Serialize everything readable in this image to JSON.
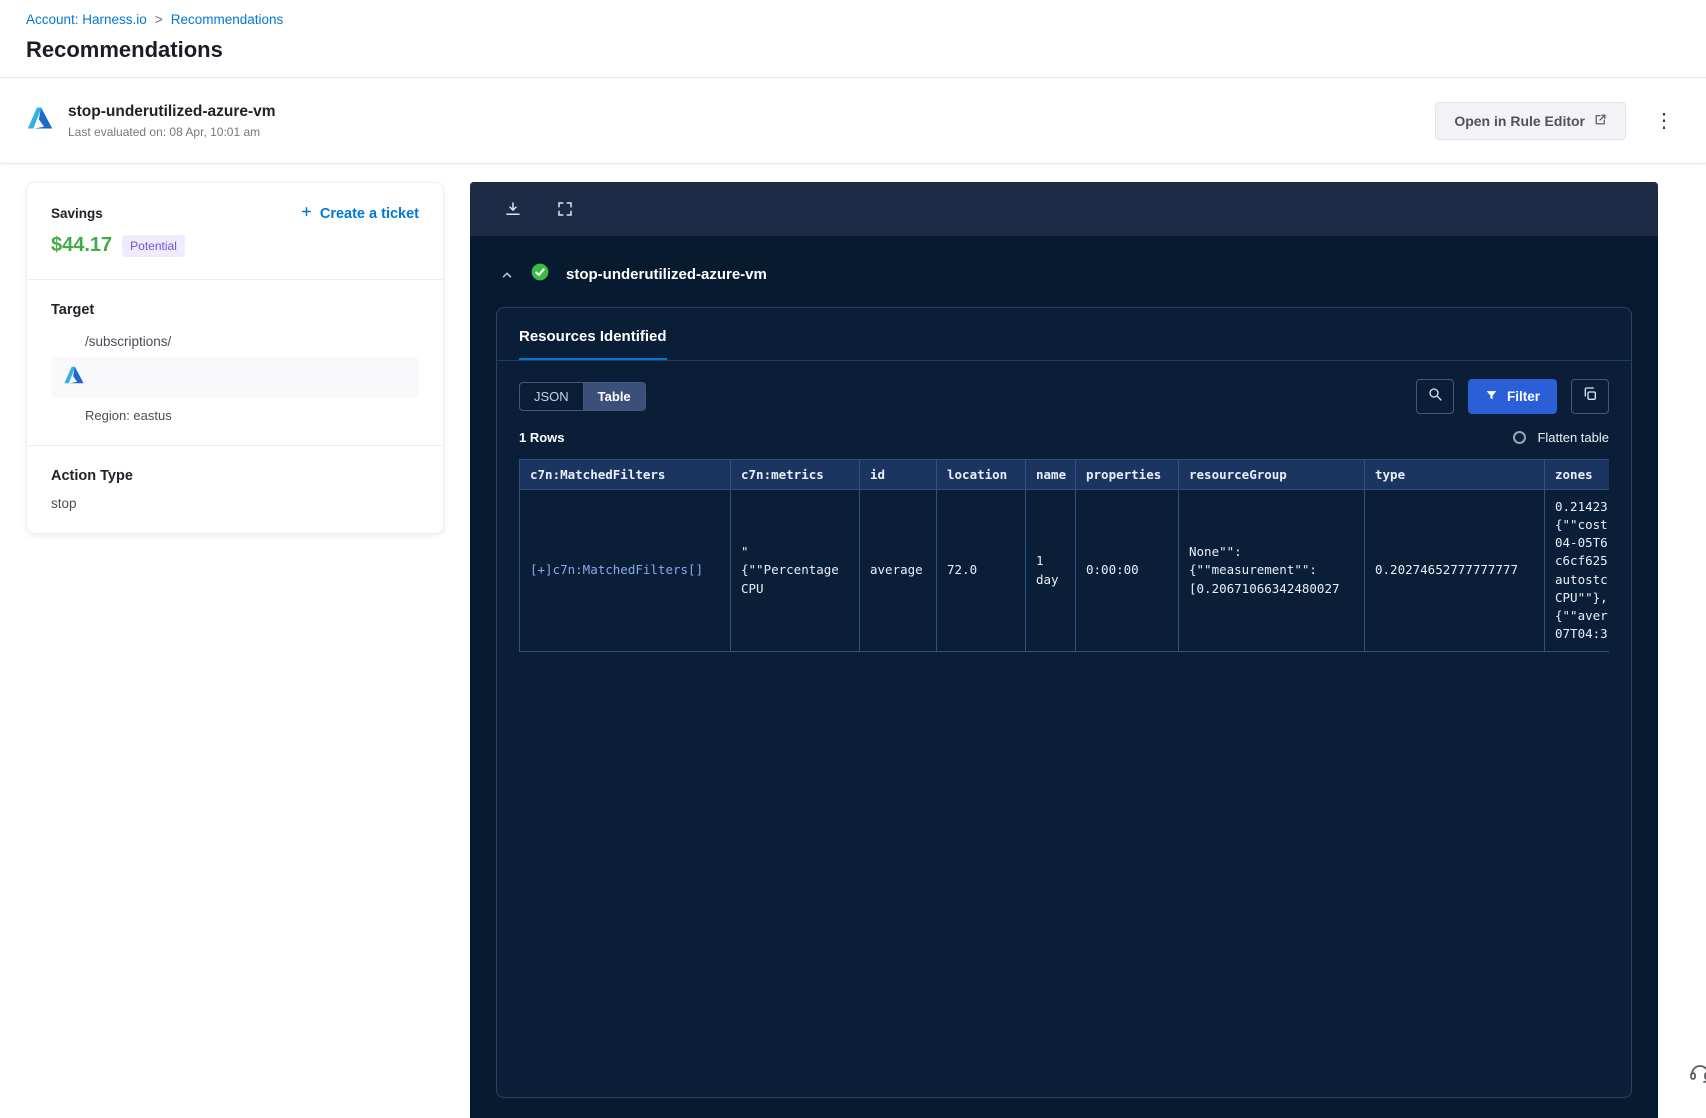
{
  "icons": {
    "kebab": "⋮"
  },
  "breadcrumb": {
    "account": "Account: Harness.io",
    "separator": ">",
    "current": "Recommendations"
  },
  "page_title": "Recommendations",
  "header": {
    "title": "stop-underutilized-azure-vm",
    "subtitle": "Last evaluated on: 08 Apr, 10:01 am",
    "open_rule_editor_label": "Open in Rule Editor"
  },
  "details_card": {
    "savings_label": "Savings",
    "savings_value": "$44.17",
    "savings_badge": "Potential",
    "create_ticket_label": "Create a ticket",
    "target_label": "Target",
    "target_path": "/subscriptions/",
    "region": "Region: eastus",
    "action_type_label": "Action Type",
    "action_type_value": "stop"
  },
  "panel": {
    "title": "stop-underutilized-azure-vm",
    "tab_label": "Resources Identified",
    "view_json_label": "JSON",
    "view_table_label": "Table",
    "filter_label": "Filter",
    "rows_count": "1 Rows",
    "flatten_label": "Flatten table",
    "table": {
      "headers": [
        "c7n:MatchedFilters",
        "c7n:metrics",
        "id",
        "location",
        "name",
        "properties",
        "resourceGroup",
        "type",
        "zones"
      ],
      "row": {
        "c7n_matched_filters": "[+]c7n:MatchedFilters[]",
        "c7n_metrics": "\"\n{\"\"Percentage\nCPU",
        "id": "average",
        "location": "72.0",
        "name": "1\nday",
        "properties": "0:00:00",
        "resource_group": "None\"\":\n{\"\"measurement\"\":\n[0.20671066342480027",
        "type": "0.20274652777777777",
        "zones": "0.21423\n{\"\"cost\n04-05T6\nc6cf625\nautostc\nCPU\"\"},\n{\"\"aver\n07T04:3"
      }
    }
  }
}
